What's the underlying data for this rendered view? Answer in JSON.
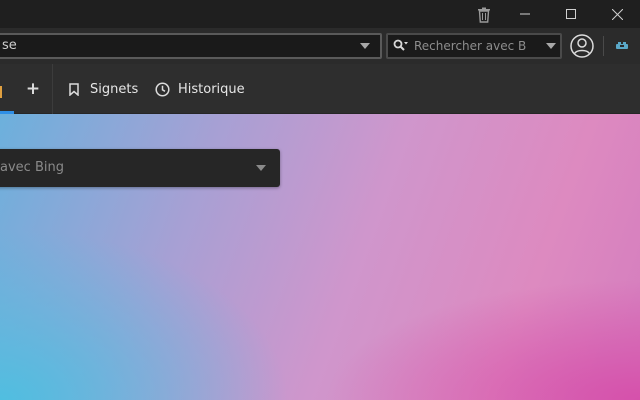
{
  "address_bar": {
    "url_text": "se"
  },
  "search_bar": {
    "placeholder": "Rechercher avec Bi"
  },
  "toolbar": {
    "new_tab_label": "+",
    "bookmarks_label": "Signets",
    "history_label": "Historique"
  },
  "page": {
    "search_placeholder": "avec Bing"
  },
  "icons": {
    "trash": "trash-icon",
    "minimize": "minimize-icon",
    "maximize": "maximize-icon",
    "close": "close-icon",
    "profile": "profile-icon",
    "extension": "extension-icon",
    "search_engine": "search-icon",
    "bookmark": "bookmark-icon",
    "history": "clock-icon"
  },
  "colors": {
    "tab_indicator": "#2f8fe6",
    "titlebar_bg": "#1f1f1f",
    "toolbar_bg": "#2e2e2e"
  }
}
